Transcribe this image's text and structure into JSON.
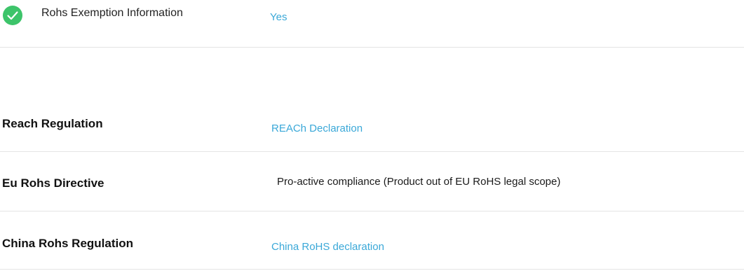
{
  "top_row": {
    "icon": "check-circle-icon",
    "icon_color": "#3dc46a",
    "label": "Rohs Exemption Information",
    "value": "Yes"
  },
  "rows": [
    {
      "label": "Reach Regulation",
      "value": "REACh Declaration",
      "value_is_link": true
    },
    {
      "label": "Eu Rohs Directive",
      "value": "Pro-active compliance (Product out of EU RoHS legal scope)",
      "value_is_link": false
    },
    {
      "label": "China Rohs Regulation",
      "value": "China RoHS declaration",
      "value_is_link": true
    }
  ],
  "colors": {
    "link": "#3aa8d8",
    "divider": "#e4e4e4",
    "check": "#3dc46a"
  }
}
